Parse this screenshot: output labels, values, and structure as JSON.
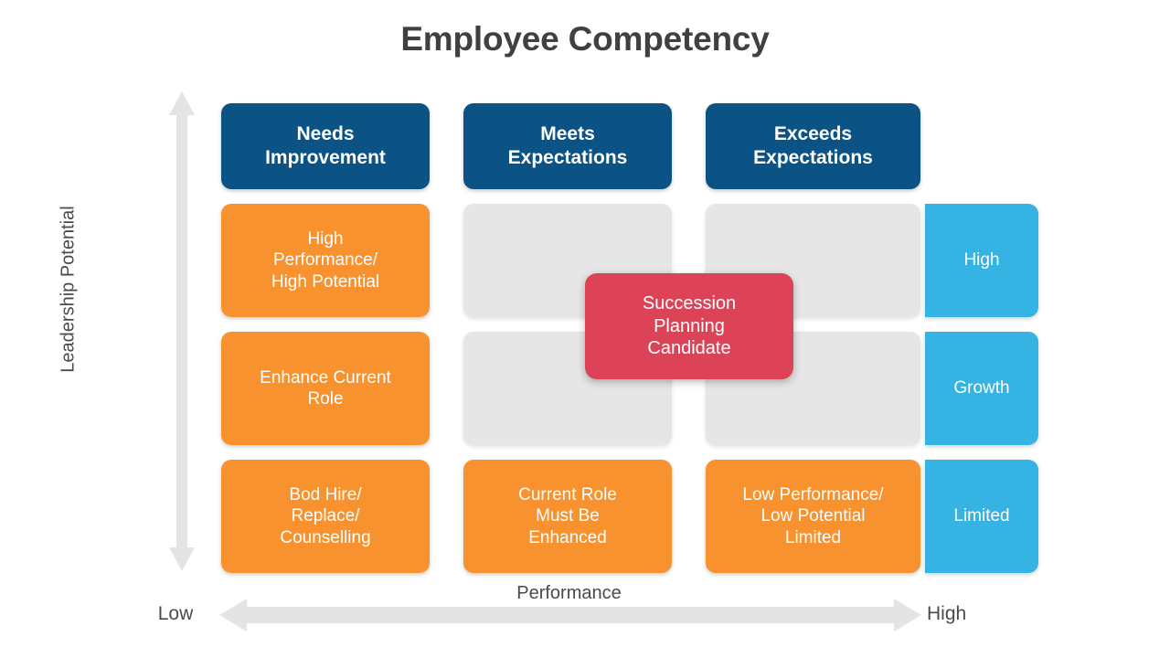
{
  "slide": {
    "title": "Employee Competency"
  },
  "axes": {
    "y_label": "Leadership Potential",
    "x_label": "Performance",
    "x_low": "Low",
    "x_high": "High",
    "arrow_color": "#E4E4E4"
  },
  "columns": [
    {
      "label": "Needs\nImprovement",
      "line1": "Needs",
      "line2": "Improvement"
    },
    {
      "label": "Meets\nExpectations",
      "line1": "Meets",
      "line2": "Expectations"
    },
    {
      "label": "Exceeds\nExpectations",
      "line1": "Exceeds",
      "line2": "Expectations"
    }
  ],
  "rows": [
    {
      "potential_label": "High",
      "cells": [
        {
          "text": "High\nPerformance/\nHigh Potential",
          "style": "orange"
        },
        {
          "text": "",
          "style": "empty"
        },
        {
          "text": "",
          "style": "empty"
        }
      ]
    },
    {
      "potential_label": "Growth",
      "cells": [
        {
          "text": "Enhance Current\nRole",
          "style": "orange"
        },
        {
          "text": "",
          "style": "empty"
        },
        {
          "text": "",
          "style": "empty"
        }
      ]
    },
    {
      "potential_label": "Limited",
      "cells": [
        {
          "text": "Bod Hire/\nReplace/\nCounselling",
          "style": "orange"
        },
        {
          "text": "Current Role\nMust Be\nEnhanced",
          "style": "orange"
        },
        {
          "text": "Low Performance/\nLow Potential\nLimited",
          "style": "orange"
        }
      ]
    }
  ],
  "callout": {
    "text": "Succession\nPlanning\nCandidate"
  },
  "colors": {
    "header_blue": "#0B5384",
    "orange": "#F7922F",
    "empty_gray": "#E6E6E6",
    "cyan": "#35B3E3",
    "callout_red": "#DC4356",
    "title_gray": "#404040",
    "background": "#FFFFFF"
  }
}
